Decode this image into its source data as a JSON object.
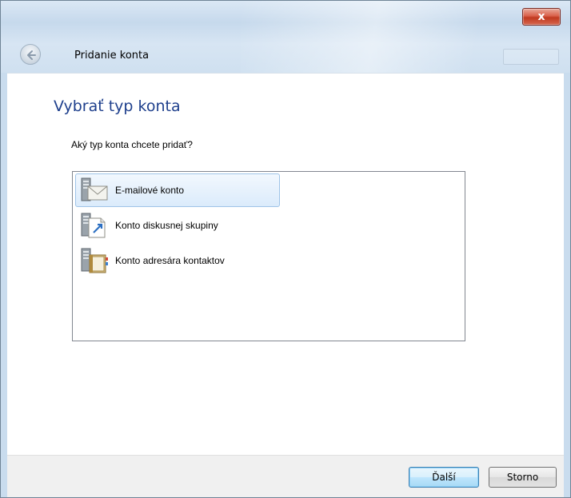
{
  "window": {
    "close_glyph": "x",
    "header_title": "Pridanie konta"
  },
  "main": {
    "heading": "Vybrať typ konta",
    "question": "Aký typ konta chcete pridať?",
    "account_types": [
      {
        "label": "E-mailové konto",
        "icon": "email-account-icon",
        "selected": true
      },
      {
        "label": "Konto diskusnej skupiny",
        "icon": "newsgroup-account-icon",
        "selected": false
      },
      {
        "label": "Konto adresára kontaktov",
        "icon": "directory-account-icon",
        "selected": false
      }
    ]
  },
  "footer": {
    "next_label": "Ďalší",
    "cancel_label": "Storno"
  },
  "colors": {
    "heading": "#1e3f8c",
    "selection_bg": "#dbebfb",
    "selection_border": "#9fc4e8",
    "close_button": "#c0391f"
  }
}
